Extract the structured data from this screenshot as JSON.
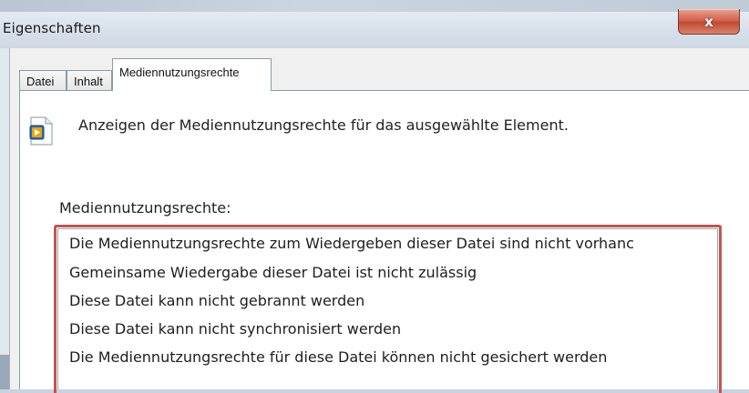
{
  "window": {
    "title": "Eigenschaften",
    "close_label": "x"
  },
  "tabs": [
    {
      "label": "Datei",
      "active": false
    },
    {
      "label": "Inhalt",
      "active": false
    },
    {
      "label": "Mediennutzungsrechte",
      "active": true
    }
  ],
  "panel": {
    "icon": "media-file-icon",
    "description": "Anzeigen der Mediennutzungsrechte für das ausgewählte Element.",
    "list_label": "Mediennutzungsrechte:",
    "rights": [
      "Die Mediennutzungsrechte zum Wiedergeben dieser Datei sind nicht vorhanc",
      "Gemeinsame Wiedergabe dieser Datei ist nicht zulässig",
      "Diese Datei kann nicht gebrannt werden",
      "Diese Datei kann nicht synchronisiert werden",
      "Die Mediennutzungsrechte für diese Datei können nicht gesichert werden"
    ]
  },
  "colors": {
    "highlight_border": "#c25550",
    "close_button": "#c24a33"
  }
}
